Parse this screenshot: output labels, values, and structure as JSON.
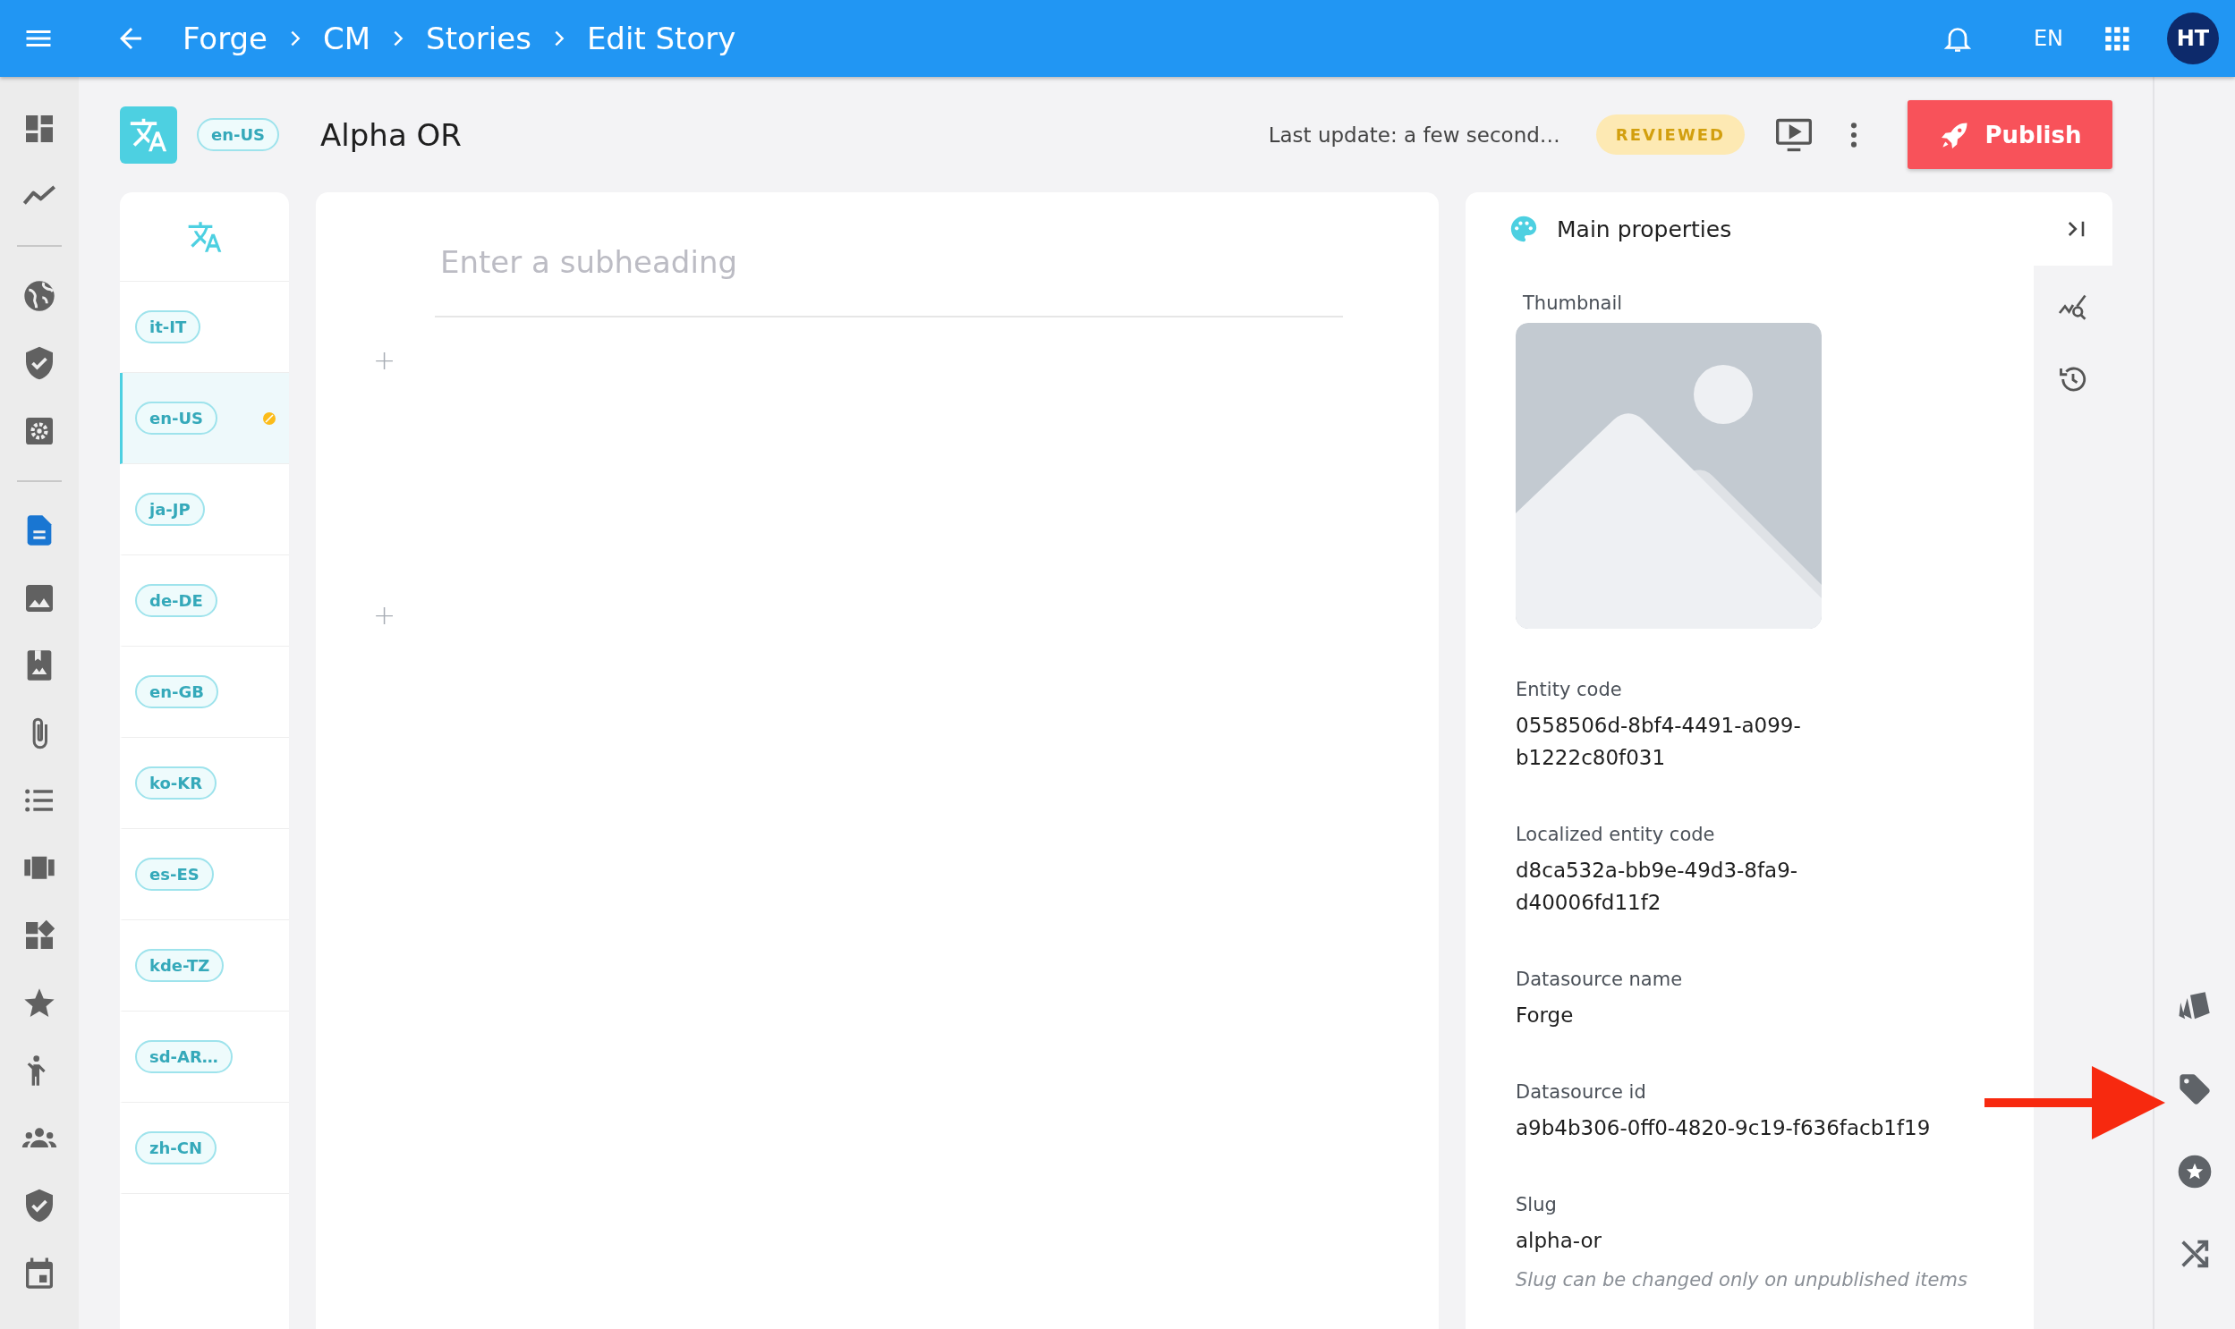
{
  "top_bar": {
    "breadcrumb": [
      "Forge",
      "CM",
      "Stories",
      "Edit Story"
    ],
    "language": "EN",
    "avatar": "HT"
  },
  "nav_items": [
    {
      "selected": false
    },
    {
      "selected": false
    },
    {
      "selected": false
    },
    {
      "selected": false
    },
    {
      "selected": false
    },
    {
      "selected": true
    },
    {
      "selected": false
    },
    {
      "selected": false
    },
    {
      "selected": false
    },
    {
      "selected": false
    },
    {
      "selected": false
    },
    {
      "selected": false
    },
    {
      "selected": false
    },
    {
      "selected": false
    },
    {
      "selected": false
    },
    {
      "selected": false
    },
    {
      "selected": false
    }
  ],
  "header": {
    "locale": "en-US",
    "title": "Alpha OR",
    "last_update": "Last update: a few second…",
    "status": "REVIEWED",
    "publish": "Publish"
  },
  "locales": [
    {
      "code": "it-IT",
      "selected": false,
      "modified": false
    },
    {
      "code": "en-US",
      "selected": true,
      "modified": true
    },
    {
      "code": "ja-JP",
      "selected": false,
      "modified": false
    },
    {
      "code": "de-DE",
      "selected": false,
      "modified": false
    },
    {
      "code": "en-GB",
      "selected": false,
      "modified": false
    },
    {
      "code": "ko-KR",
      "selected": false,
      "modified": false
    },
    {
      "code": "es-ES",
      "selected": false,
      "modified": false
    },
    {
      "code": "kde-TZ",
      "selected": false,
      "modified": false
    },
    {
      "code": "sd-AR…",
      "selected": false,
      "modified": false
    },
    {
      "code": "zh-CN",
      "selected": false,
      "modified": false
    }
  ],
  "editor": {
    "subheading_placeholder": "Enter a subheading",
    "add_buttons": [
      "+",
      "+"
    ]
  },
  "properties": {
    "title": "Main properties",
    "thumbnail_label": "Thumbnail",
    "fields": [
      {
        "label": "Entity code",
        "value": "0558506d-8bf4-4491-a099-b1222c80f031"
      },
      {
        "label": "Localized entity code",
        "value": "d8ca532a-bb9e-49d3-8fa9-d40006fd11f2"
      },
      {
        "label": "Datasource name",
        "value": "Forge"
      },
      {
        "label": "Datasource id",
        "value": "a9b4b306-0ff0-4820-9c19-f636facb1f19"
      },
      {
        "label": "Slug",
        "value": "alpha-or",
        "hint": "Slug can be changed only on unpublished items"
      }
    ]
  }
}
